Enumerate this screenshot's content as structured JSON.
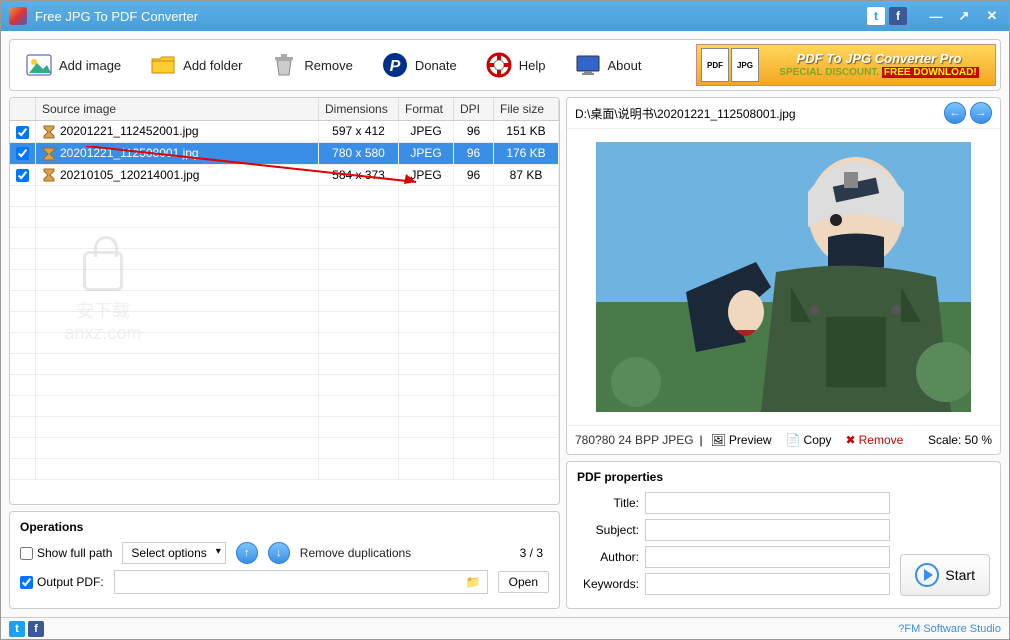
{
  "window": {
    "title": "Free JPG To PDF Converter"
  },
  "toolbar": {
    "add_image": "Add image",
    "add_folder": "Add folder",
    "remove": "Remove",
    "donate": "Donate",
    "help": "Help",
    "about": "About"
  },
  "banner": {
    "line1": "PDF To JPG Converter Pro",
    "line2a": "SPECIAL DISCOUNT.",
    "line2b": "FREE DOWNLOAD!"
  },
  "table": {
    "headers": {
      "source": "Source image",
      "dim": "Dimensions",
      "fmt": "Format",
      "dpi": "DPI",
      "size": "File size"
    },
    "rows": [
      {
        "checked": true,
        "name": "20201221_112452001.jpg",
        "dim": "597 x 412",
        "fmt": "JPEG",
        "dpi": "96",
        "size": "151 KB",
        "sel": false
      },
      {
        "checked": true,
        "name": "20201221_112508001.jpg",
        "dim": "780 x 580",
        "fmt": "JPEG",
        "dpi": "96",
        "size": "176 KB",
        "sel": true
      },
      {
        "checked": true,
        "name": "20210105_120214001.jpg",
        "dim": "584 x 373",
        "fmt": "JPEG",
        "dpi": "96",
        "size": "87 KB",
        "sel": false
      }
    ]
  },
  "operations": {
    "title": "Operations",
    "show_full_path": "Show full path",
    "show_full_path_checked": false,
    "select_options": "Select options",
    "remove_dup": "Remove duplications",
    "counter": "3 / 3",
    "output_pdf": "Output PDF:",
    "output_pdf_checked": true,
    "open": "Open"
  },
  "preview": {
    "path": "D:\\桌面\\说明书\\20201221_112508001.jpg",
    "info": "780?80  24 BPP  JPEG",
    "preview_btn": "Preview",
    "copy_btn": "Copy",
    "remove_btn": "Remove",
    "scale": "Scale: 50 %"
  },
  "pdf": {
    "title": "PDF properties",
    "labels": {
      "title": "Title:",
      "subject": "Subject:",
      "author": "Author:",
      "keywords": "Keywords:"
    },
    "values": {
      "title": "",
      "subject": "",
      "author": "",
      "keywords": ""
    }
  },
  "start": "Start",
  "watermark": {
    "text1": "安下载",
    "text2": "anxz.com"
  },
  "status": {
    "credit": "?FM Software Studio"
  }
}
